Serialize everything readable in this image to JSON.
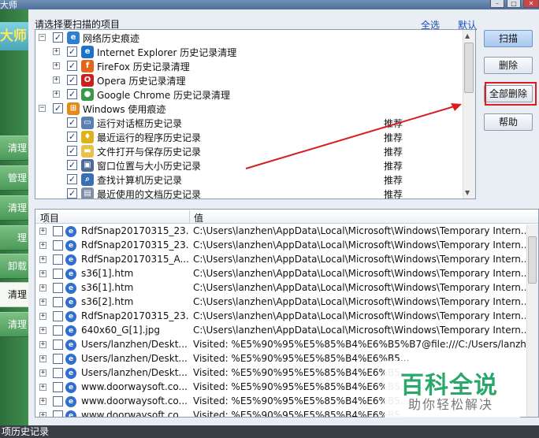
{
  "window": {
    "title": "大师"
  },
  "sidebar": {
    "logo": "大师",
    "items": [
      {
        "label": "清理"
      },
      {
        "label": "管理"
      },
      {
        "label": "清理"
      },
      {
        "label": "理"
      },
      {
        "label": "卸载"
      },
      {
        "label": "清理"
      },
      {
        "label": "清理"
      }
    ],
    "selected_index": 5
  },
  "scan_panel": {
    "title": "请选择要扫描的项目",
    "select_all": "全选",
    "default": "默认",
    "tree": [
      {
        "label": "网络历史痕迹",
        "level": 0,
        "expanded": true,
        "checked": true,
        "icon": "globe-icon"
      },
      {
        "label": "Internet Explorer 历史记录清理",
        "level": 1,
        "expanded": false,
        "checked": true,
        "icon": "ie-icon"
      },
      {
        "label": "FireFox 历史记录清理",
        "level": 1,
        "expanded": false,
        "checked": true,
        "icon": "firefox-icon"
      },
      {
        "label": "Opera 历史记录清理",
        "level": 1,
        "expanded": false,
        "checked": true,
        "icon": "opera-icon"
      },
      {
        "label": "Google Chrome 历史记录清理",
        "level": 1,
        "expanded": false,
        "checked": true,
        "icon": "chrome-icon"
      },
      {
        "label": "Windows 使用痕迹",
        "level": 0,
        "expanded": true,
        "checked": true,
        "icon": "windows-icon"
      },
      {
        "label": "运行对话框历史记录",
        "level": 1,
        "checked": true,
        "icon": "run-icon",
        "tag": "推荐"
      },
      {
        "label": "最近运行的程序历史记录",
        "level": 1,
        "checked": true,
        "icon": "footprint-icon",
        "tag": "推荐"
      },
      {
        "label": "文件打开与保存历史记录",
        "level": 1,
        "checked": true,
        "icon": "folder-icon",
        "tag": "推荐"
      },
      {
        "label": "窗口位置与大小历史记录",
        "level": 1,
        "checked": true,
        "icon": "window-icon",
        "tag": "推荐"
      },
      {
        "label": "查找计算机历史记录",
        "level": 1,
        "checked": true,
        "icon": "search-icon",
        "tag": "推荐"
      },
      {
        "label": "最近使用的文档历史记录",
        "level": 1,
        "checked": true,
        "icon": "document-icon",
        "tag": "推荐"
      }
    ]
  },
  "buttons": {
    "scan": "扫描",
    "delete": "删除",
    "delete_all": "全部删除",
    "help": "帮助"
  },
  "results": {
    "col_item": "项目",
    "col_value": "值",
    "rows": [
      {
        "item": "RdfSnap20170315_23...",
        "value": "C:\\Users\\lanzhen\\AppData\\Local\\Microsoft\\Windows\\Temporary Intern..."
      },
      {
        "item": "RdfSnap20170315_23...",
        "value": "C:\\Users\\lanzhen\\AppData\\Local\\Microsoft\\Windows\\Temporary Intern..."
      },
      {
        "item": "RdfSnap20170315_A...",
        "value": "C:\\Users\\lanzhen\\AppData\\Local\\Microsoft\\Windows\\Temporary Intern..."
      },
      {
        "item": "s36[1].htm",
        "value": "C:\\Users\\lanzhen\\AppData\\Local\\Microsoft\\Windows\\Temporary Intern..."
      },
      {
        "item": "s36[1].htm",
        "value": "C:\\Users\\lanzhen\\AppData\\Local\\Microsoft\\Windows\\Temporary Intern..."
      },
      {
        "item": "s36[2].htm",
        "value": "C:\\Users\\lanzhen\\AppData\\Local\\Microsoft\\Windows\\Temporary Intern..."
      },
      {
        "item": "RdfSnap20170315_23...",
        "value": "C:\\Users\\lanzhen\\AppData\\Local\\Microsoft\\Windows\\Temporary Intern..."
      },
      {
        "item": "640x60_G[1].jpg",
        "value": "C:\\Users\\lanzhen\\AppData\\Local\\Microsoft\\Windows\\Temporary Intern..."
      },
      {
        "item": "Users/lanzhen/Deskt...",
        "value": "Visited: %E5%90%95%E5%85%B4%E6%B5%B7@file:///C:/Users/lanzhe..."
      },
      {
        "item": "Users/lanzhen/Deskt...",
        "value": "Visited: %E5%90%95%E5%85%B4%E6%B5..."
      },
      {
        "item": "Users/lanzhen/Deskt...",
        "value": "Visited: %E5%90%95%E5%85%B4%E6%B5..."
      },
      {
        "item": "www.doorwaysoft.co...",
        "value": "Visited: %E5%90%95%E5%85%B4%E6%B5..."
      },
      {
        "item": "www.doorwaysoft.co...",
        "value": "Visited: %E5%90%95%E5%85%B4%E6%B5..."
      },
      {
        "item": "www.doorwaysoft.co...",
        "value": "Visited: %E5%90%95%E5%85%B4%E6%B5..."
      }
    ]
  },
  "status": {
    "text": "项历史记录"
  },
  "watermark": {
    "title": "百科全说",
    "subtitle": "助你轻松解决"
  },
  "colors": {
    "annotation_red": "#d62020",
    "link_blue": "#1a4fb3",
    "watermark_green": "#2aa86a"
  }
}
